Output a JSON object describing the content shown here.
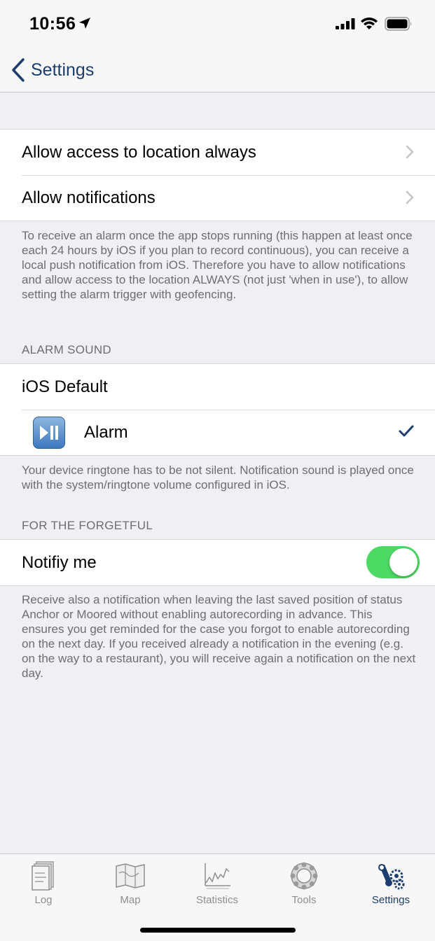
{
  "status_bar": {
    "time": "10:56"
  },
  "nav": {
    "back_label": "Settings"
  },
  "permissions": {
    "items": [
      {
        "label": "Allow access to location always"
      },
      {
        "label": "Allow notifications"
      }
    ],
    "footer": "To receive an alarm once the app stops running (this happen at least once each 24 hours by iOS if you plan to record continuous), you can receive a local push notification from iOS. Therefore you have to allow notifications and allow access to the location ALWAYS (not just 'when in use'), to allow setting the alarm trigger with geofencing."
  },
  "alarm_sound": {
    "header": "ALARM SOUND",
    "default_label": "iOS Default",
    "alarm_label": "Alarm",
    "alarm_selected": true,
    "footer": "Your device ringtone has to be not silent. Notification sound is played once with the system/ringtone volume configured in iOS."
  },
  "forgetful": {
    "header": "FOR THE FORGETFUL",
    "notify_label": "Notifiy me",
    "notify_on": true,
    "footer": "Receive also a notification when leaving the last saved position of status Anchor or Moored without enabling autorecording in advance. This ensures you get reminded for the case you forgot to enable autorecording on the next day. If you received already a notification in the evening (e.g. on the way to a restaurant), you will receive again a notification on the next day."
  },
  "tabs": [
    {
      "label": "Log",
      "icon": "logbook-icon",
      "active": false
    },
    {
      "label": "Map",
      "icon": "map-icon",
      "active": false
    },
    {
      "label": "Statistics",
      "icon": "statistics-icon",
      "active": false
    },
    {
      "label": "Tools",
      "icon": "life-ring-icon",
      "active": false
    },
    {
      "label": "Settings",
      "icon": "gears-icon",
      "active": true
    }
  ],
  "colors": {
    "accent": "#1c3d6e",
    "toggle_on": "#4cd964",
    "background": "#efeff4"
  }
}
